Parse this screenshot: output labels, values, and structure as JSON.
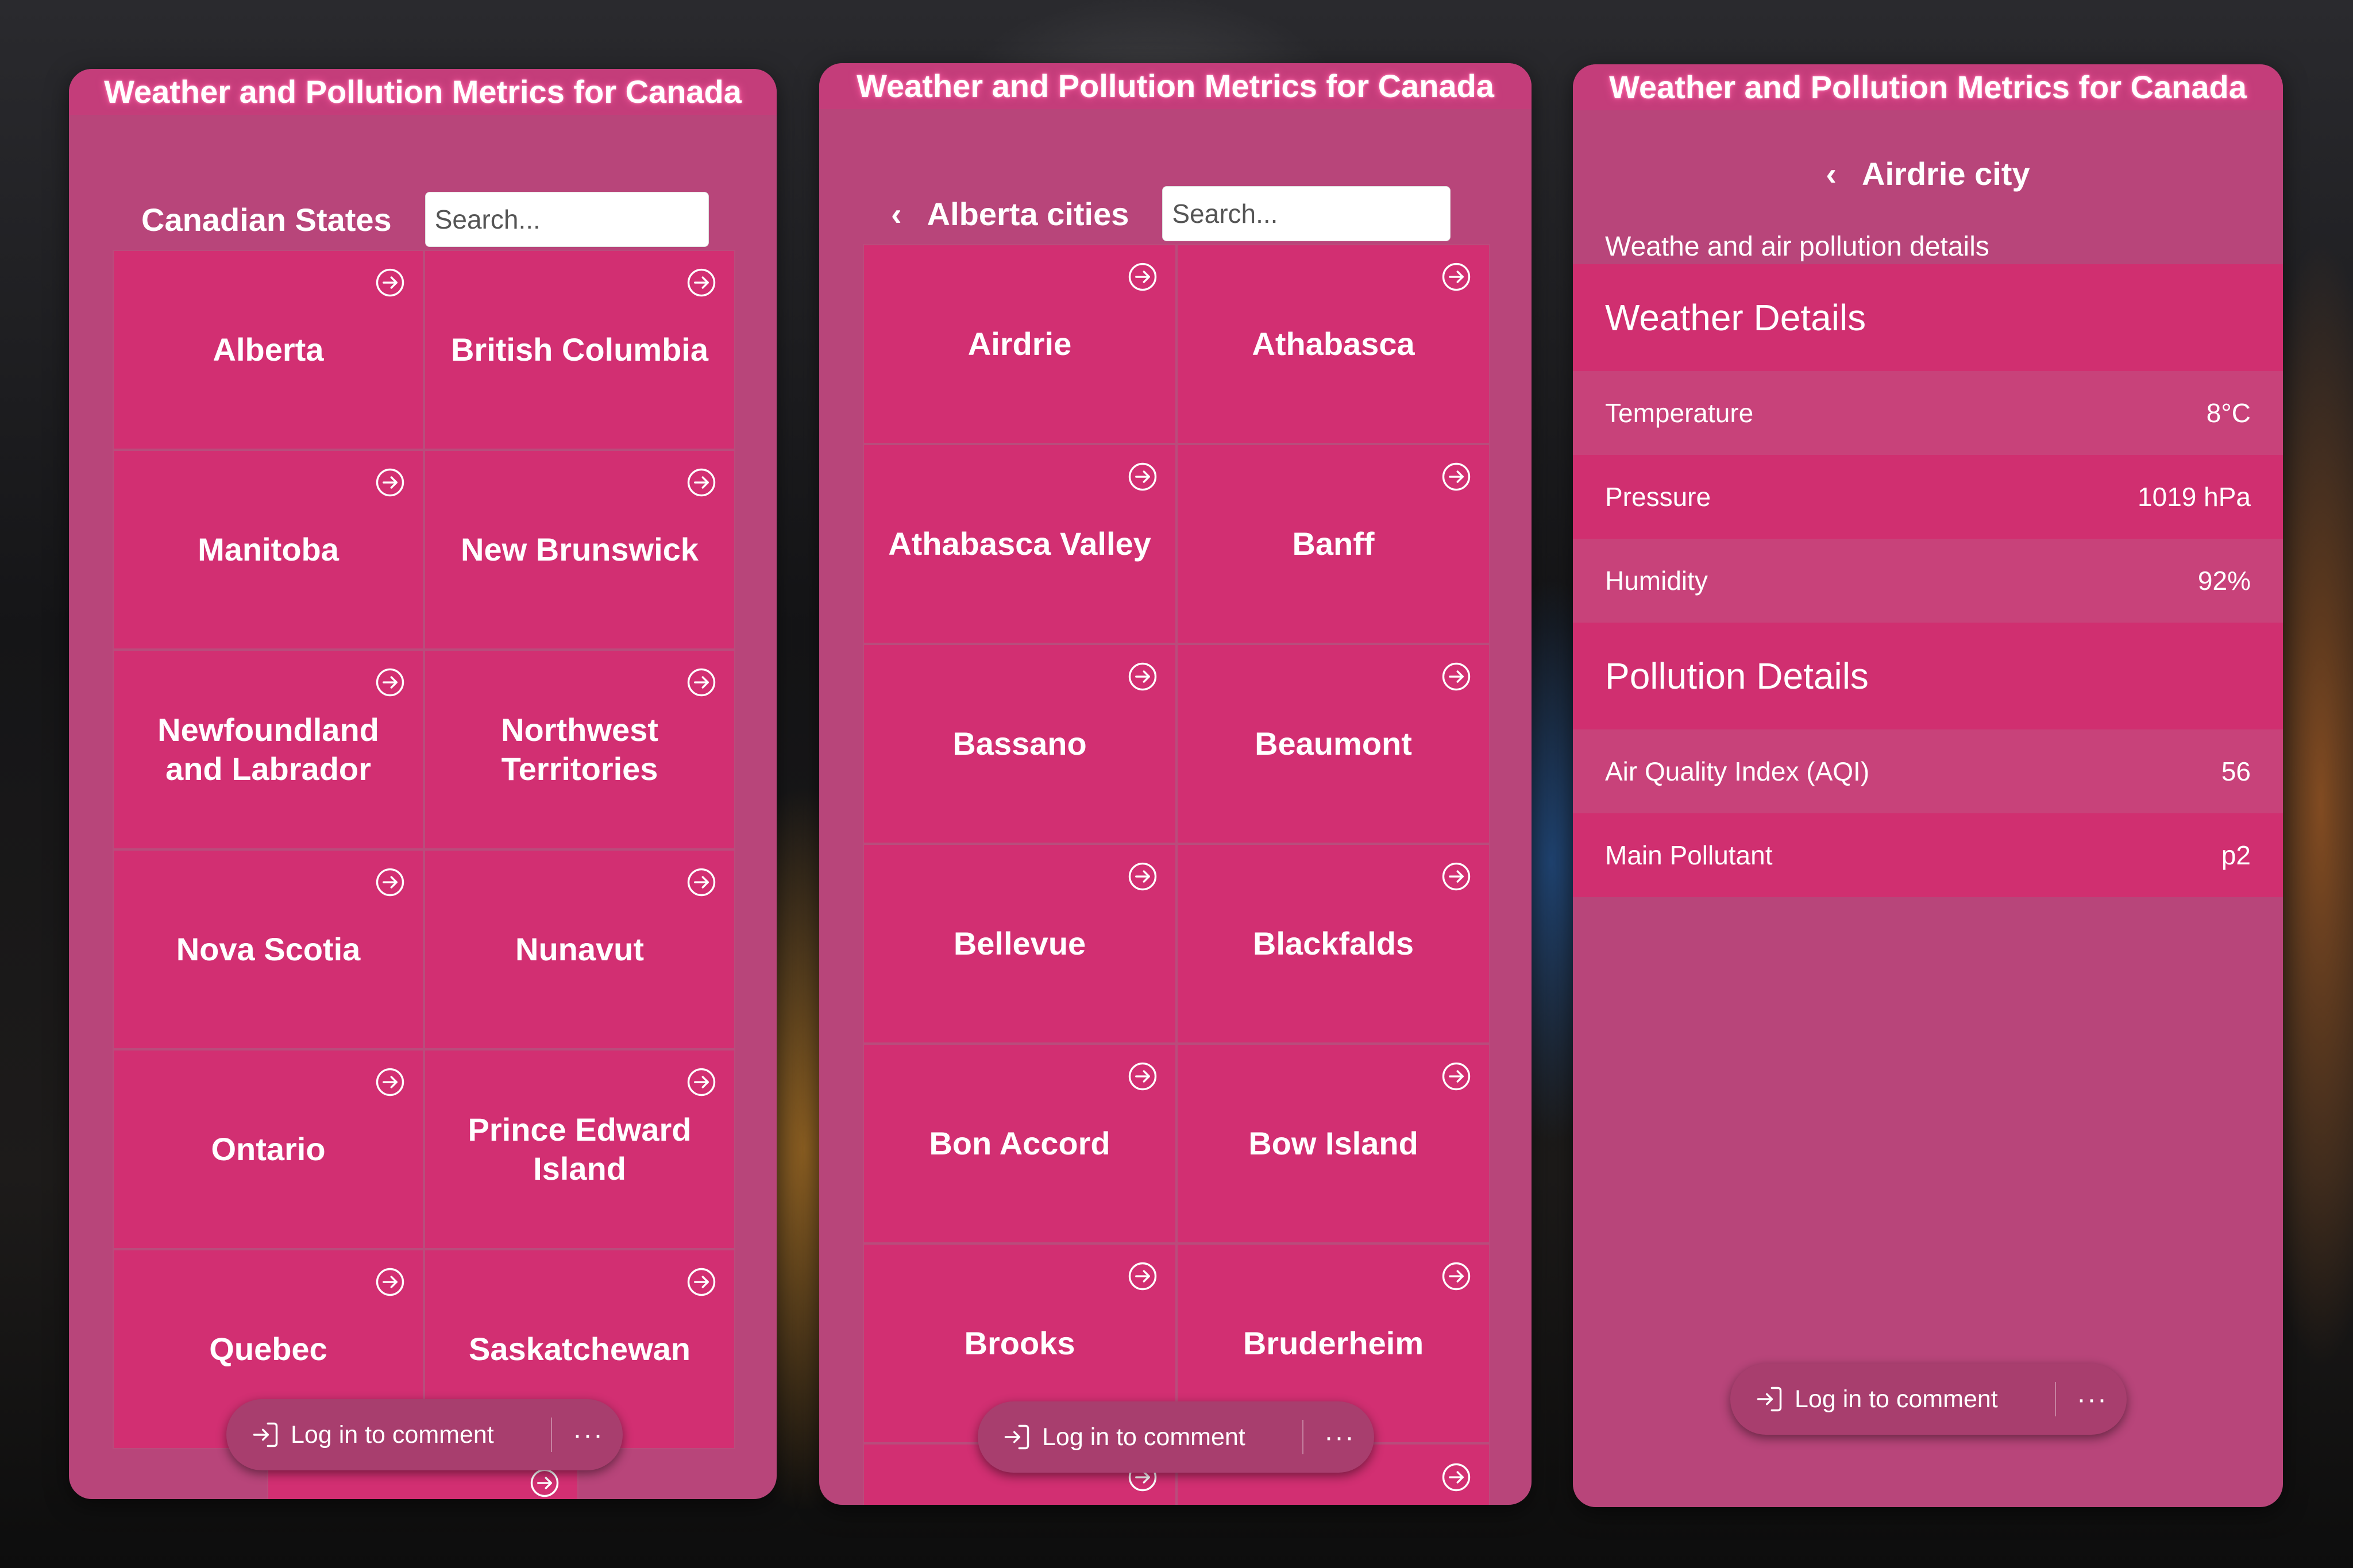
{
  "app": {
    "title": "Weather and Pollution Metrics for Canada"
  },
  "states_screen": {
    "header": "Canadian States",
    "search_placeholder": "Search...",
    "tiles": [
      "Alberta",
      "British Columbia",
      "Manitoba",
      "New Brunswick",
      "Newfoundland and Labrador",
      "Northwest Territories",
      "Nova Scotia",
      "Nunavut",
      "Ontario",
      "Prince Edward Island",
      "Quebec",
      "Saskatchewan"
    ]
  },
  "cities_screen": {
    "back_icon": "chevron-left-icon",
    "header": "Alberta cities",
    "search_placeholder": "Search...",
    "tiles": [
      "Airdrie",
      "Athabasca",
      "Athabasca Valley",
      "Banff",
      "Bassano",
      "Beaumont",
      "Bellevue",
      "Blackfalds",
      "Bon Accord",
      "Bow Island",
      "Brooks",
      "Bruderheim"
    ]
  },
  "details_screen": {
    "back_icon": "chevron-left-icon",
    "header": "Airdrie city",
    "subtitle": "Weathe and air pollution details",
    "weather": {
      "title": "Weather Details",
      "rows": [
        {
          "label": "Temperature",
          "value": "8°C"
        },
        {
          "label": "Pressure",
          "value": "1019 hPa"
        },
        {
          "label": "Humidity",
          "value": "92%"
        }
      ]
    },
    "pollution": {
      "title": "Pollution Details",
      "rows": [
        {
          "label": "Air Quality Index (AQI)",
          "value": "56"
        },
        {
          "label": "Main Pollutant",
          "value": "p2"
        }
      ]
    }
  },
  "comment_bar": {
    "login_label": "Log in to comment",
    "more_label": "···"
  },
  "colors": {
    "panel_bg": "#b8457a",
    "tile_bg": "#d22f72",
    "title_glow": "#ff5aa0"
  }
}
